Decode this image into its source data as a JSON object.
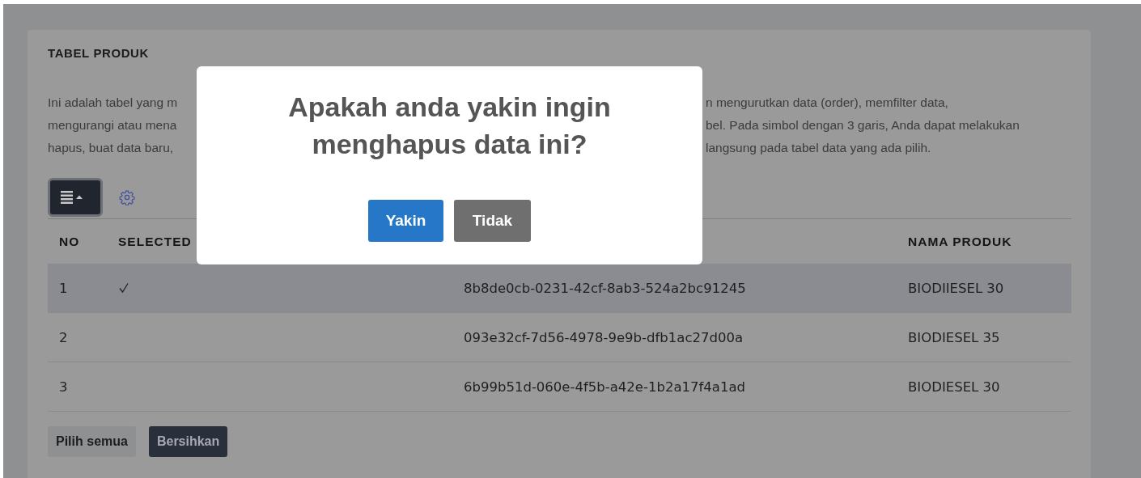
{
  "card": {
    "title": "TABEL PRODUK",
    "description_lines": [
      {
        "left": "Ini adalah tabel yang m",
        "right": "n mengurutkan data (order), memfilter data,"
      },
      {
        "left": "mengurangi atau mena",
        "right": "bel. Pada simbol dengan 3 garis, Anda dapat melakukan"
      },
      {
        "left": "hapus, buat data baru,",
        "right": "langsung pada tabel data yang ada pilih."
      }
    ]
  },
  "table": {
    "columns": [
      "NO",
      "SELECTED",
      "",
      "NAMA PRODUK"
    ],
    "rows": [
      {
        "no": "1",
        "selected": true,
        "column_3": "8b8de0cb-0231-42cf-8ab3-524a2bc91245",
        "nama_produk": "BIODIIESEL 30"
      },
      {
        "no": "2",
        "selected": false,
        "column_3": "093e32cf-7d56-4978-9e9b-dfb1ac27d00a",
        "nama_produk": "BIODIESEL 35"
      },
      {
        "no": "3",
        "selected": false,
        "column_3": "6b99b51d-060e-4f5b-a42e-1b2a17f4a1ad",
        "nama_produk": "BIODIESEL 30"
      }
    ]
  },
  "footer_buttons": [
    "Pilih semua",
    "Bersihkan"
  ],
  "dialog": {
    "message": "Apakah anda yakin ingin menghapus data ini?",
    "buttons": [
      {
        "label": "Yakin",
        "kind": "confirm"
      },
      {
        "label": "Tidak",
        "kind": "cancel"
      }
    ]
  }
}
